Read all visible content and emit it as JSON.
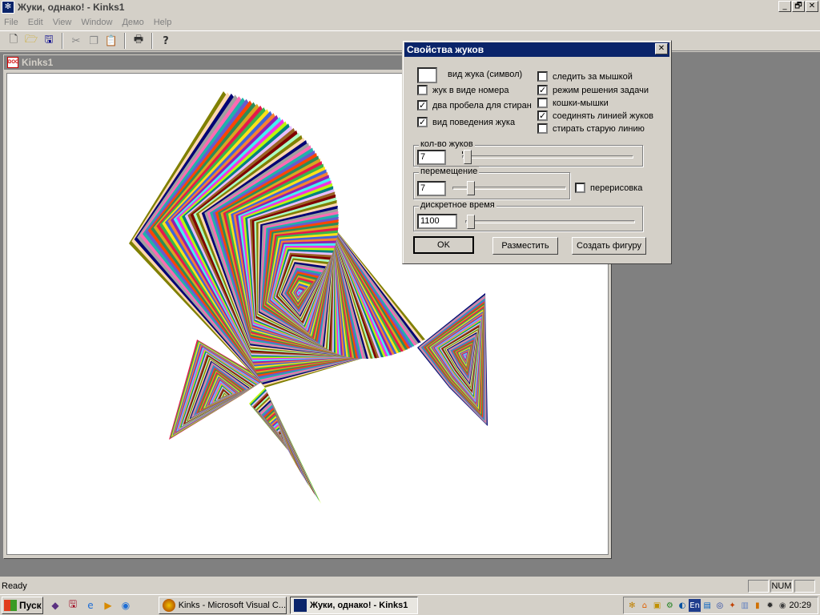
{
  "window": {
    "title": "Жуки, однако! - Kinks1",
    "app_icon": "bug-app-icon",
    "minimize": "_",
    "restore": "🗗",
    "close": "✕"
  },
  "menu": [
    "File",
    "Edit",
    "View",
    "Window",
    "Демо",
    "Help"
  ],
  "toolbar": {
    "buttons": [
      "new-icon",
      "open-icon",
      "save-icon",
      "cut-icon",
      "copy-icon",
      "paste-icon",
      "print-icon",
      "help-icon"
    ]
  },
  "child": {
    "title": "Kinks1"
  },
  "dialog": {
    "title": "Свойства жуков",
    "close": "✕",
    "symbol_label": "вид жука (символ)",
    "checks_left": [
      {
        "label": "жук в виде номера",
        "checked": false
      },
      {
        "label": "два пробела для стиран",
        "checked": true
      },
      {
        "label": "вид поведения жука",
        "checked": true
      }
    ],
    "checks_right": [
      {
        "label": "следить за мышкой",
        "checked": false
      },
      {
        "label": "режим решения задачи",
        "checked": true
      },
      {
        "label": "кошки-мышки",
        "checked": false
      },
      {
        "label": "соединять линией жуков",
        "checked": true
      },
      {
        "label": "стирать старую линию",
        "checked": false
      }
    ],
    "count_group": {
      "legend": "кол-во жуков",
      "value": "7"
    },
    "move_group": {
      "legend": "перемещение",
      "value": "7"
    },
    "redraw": {
      "label": "перерисовка",
      "checked": false
    },
    "time_group": {
      "legend": "дискретное время",
      "value": "1100"
    },
    "check_mark": "✓",
    "buttons": {
      "ok": "OK",
      "place": "Разместить",
      "create": "Создать фигуру"
    }
  },
  "status": {
    "message": "Ready",
    "num": "NUM"
  },
  "taskbar": {
    "start": "Пуск",
    "tasks": [
      {
        "label": "Kinks - Microsoft Visual C...",
        "active": false
      },
      {
        "label": "Жуки, однако! - Kinks1",
        "active": true
      }
    ],
    "tray_lang": "En",
    "clock": "20:29"
  }
}
